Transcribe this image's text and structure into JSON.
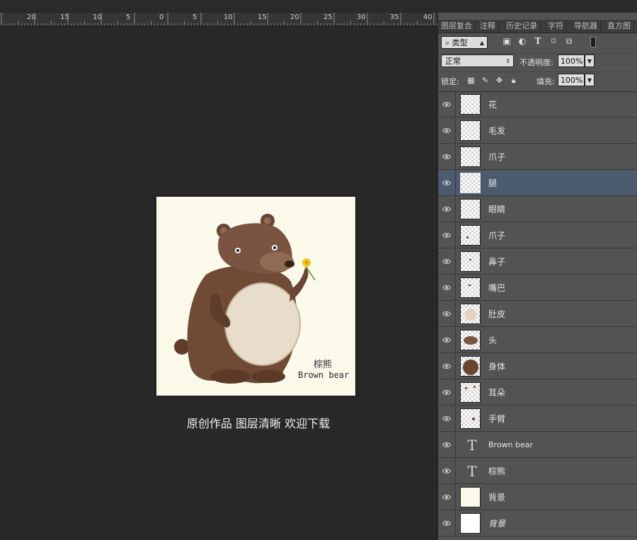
{
  "ruler": {
    "labels": [
      "20",
      "15",
      "10",
      "5",
      "0",
      "5",
      "10",
      "15",
      "20",
      "25",
      "30",
      "35",
      "40"
    ]
  },
  "caption": "原创作品 图层清晰 欢迎下载",
  "artwork": {
    "title_cn": "棕熊",
    "title_en": "Brown bear"
  },
  "panel": {
    "tabs": [
      "图层复合",
      "注释",
      "历史记录",
      "字符",
      "导航器",
      "直方图"
    ],
    "filter": {
      "label": "类型"
    },
    "blend": {
      "mode": "正常",
      "opacity_label": "不透明度:",
      "opacity_value": "100%"
    },
    "lock": {
      "lock_label": "锁定:",
      "fill_label": "填充:",
      "fill_value": "100%"
    },
    "layers": [
      {
        "name": "花",
        "type": "raster"
      },
      {
        "name": "毛发",
        "type": "raster"
      },
      {
        "name": "爪子",
        "type": "raster"
      },
      {
        "name": "腿",
        "type": "raster",
        "selected": true
      },
      {
        "name": "眼睛",
        "type": "raster"
      },
      {
        "name": "爪子",
        "type": "raster"
      },
      {
        "name": "鼻子",
        "type": "raster"
      },
      {
        "name": "嘴巴",
        "type": "raster"
      },
      {
        "name": "肚皮",
        "type": "raster"
      },
      {
        "name": "头",
        "type": "raster"
      },
      {
        "name": "身体",
        "type": "raster"
      },
      {
        "name": "耳朵",
        "type": "raster"
      },
      {
        "name": "手臂",
        "type": "raster"
      },
      {
        "name": "Brown bear",
        "type": "text"
      },
      {
        "name": "棕熊",
        "type": "text"
      },
      {
        "name": "背景",
        "type": "raster"
      },
      {
        "name": "背景",
        "type": "background"
      }
    ]
  },
  "colors": {
    "panel": "#535353",
    "selected_layer": "#4c5a6e",
    "canvas_bg": "#282828",
    "artboard": "#fbf9ea",
    "bear_brown": "#6f4a35"
  }
}
